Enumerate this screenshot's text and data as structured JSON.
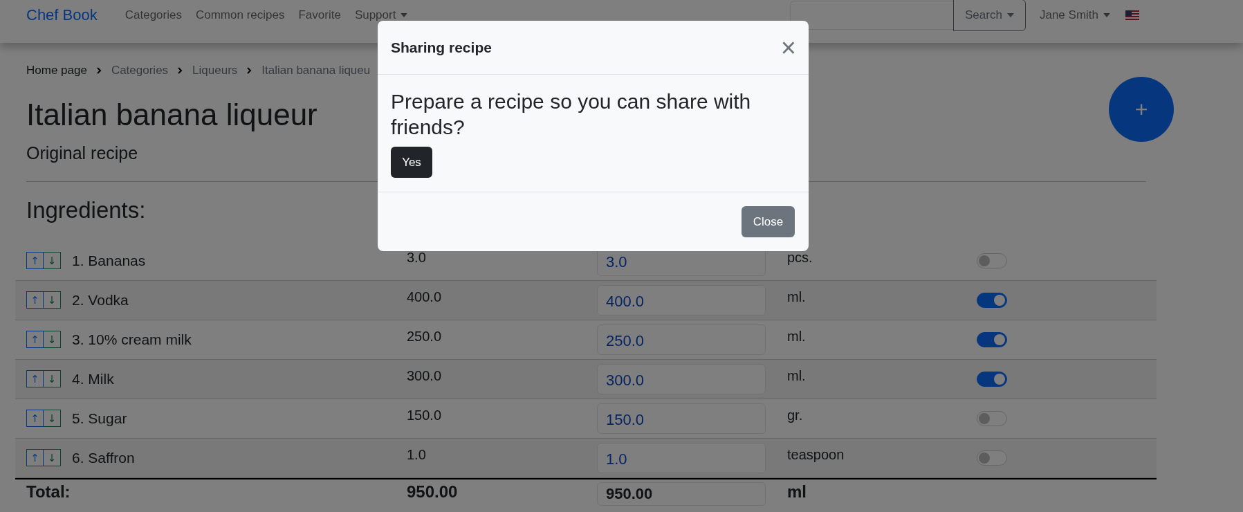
{
  "navbar": {
    "brand": "Chef Book",
    "links": [
      {
        "label": "Categories",
        "dropdown": false
      },
      {
        "label": "Common recipes",
        "dropdown": false
      },
      {
        "label": "Favorite",
        "dropdown": false
      },
      {
        "label": "Support",
        "dropdown": true
      }
    ],
    "search_button": "Search",
    "user": "Jane Smith"
  },
  "breadcrumbs": [
    "Home page",
    "Categories",
    "Liqueurs",
    "Italian banana liqueu"
  ],
  "add_button": "+",
  "title": "Italian banana liqueur",
  "subtitle": "Original recipe",
  "section_heading": "Ingredients:",
  "ingredients": [
    {
      "move": [
        "↑",
        "↓"
      ],
      "name": "1. Bananas",
      "amount": "3.0",
      "value": "3.0",
      "unit": "pcs.",
      "on": false
    },
    {
      "move": [
        "↑",
        "↓"
      ],
      "name": "2. Vodka",
      "amount": "400.0",
      "value": "400.0",
      "unit": "ml.",
      "on": true
    },
    {
      "move": [
        "↑",
        "↓"
      ],
      "name": "3. 10% cream milk",
      "amount": "250.0",
      "value": "250.0",
      "unit": "ml.",
      "on": true
    },
    {
      "move": [
        "↑",
        "↓"
      ],
      "name": "4. Milk",
      "amount": "300.0",
      "value": "300.0",
      "unit": "ml.",
      "on": true
    },
    {
      "move": [
        "↑",
        "↓"
      ],
      "name": "5. Sugar",
      "amount": "150.0",
      "value": "150.0",
      "unit": "gr.",
      "on": false
    },
    {
      "move": [
        "↑",
        "↓"
      ],
      "name": "6. Saffron",
      "amount": "1.0",
      "value": "1.0",
      "unit": "teaspoon",
      "on": false
    }
  ],
  "total": {
    "label": "Total:",
    "amount": "950.00",
    "value": "950.00",
    "unit": "ml"
  },
  "modal": {
    "title": "Sharing recipe",
    "close_icon": "×",
    "question": "Prepare a recipe so you can share with friends?",
    "yes_button": "Yes",
    "close_button": "Close"
  }
}
